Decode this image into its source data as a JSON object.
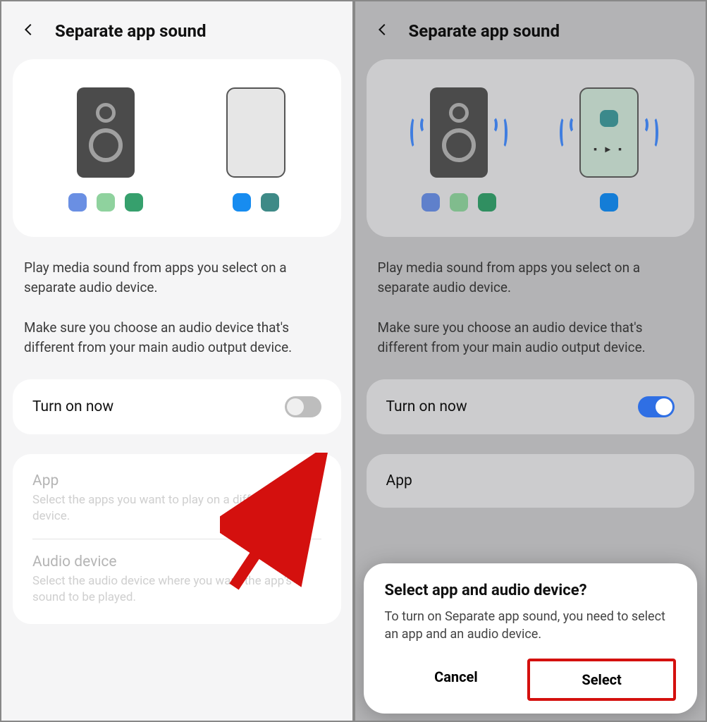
{
  "left": {
    "title": "Separate app sound",
    "desc1": "Play media sound from apps you select on a separate audio device.",
    "desc2": "Make sure you choose an audio device that's different from your main audio output device.",
    "toggle_label": "Turn on now",
    "toggle_on": false,
    "app": {
      "title": "App",
      "subtitle": "Select the apps you want to play on a different audio device."
    },
    "audio": {
      "title": "Audio device",
      "subtitle": "Select the audio device where you want the app's sound to be played."
    }
  },
  "right": {
    "title": "Separate app sound",
    "desc1": "Play media sound from apps you select on a separate audio device.",
    "desc2": "Make sure you choose an audio device that's different from your main audio output device.",
    "toggle_label": "Turn on now",
    "toggle_on": true,
    "app_title": "App",
    "dialog": {
      "title": "Select app and audio device?",
      "body": "To turn on Separate app sound, you need to select an app and an audio device.",
      "cancel": "Cancel",
      "select": "Select"
    }
  }
}
